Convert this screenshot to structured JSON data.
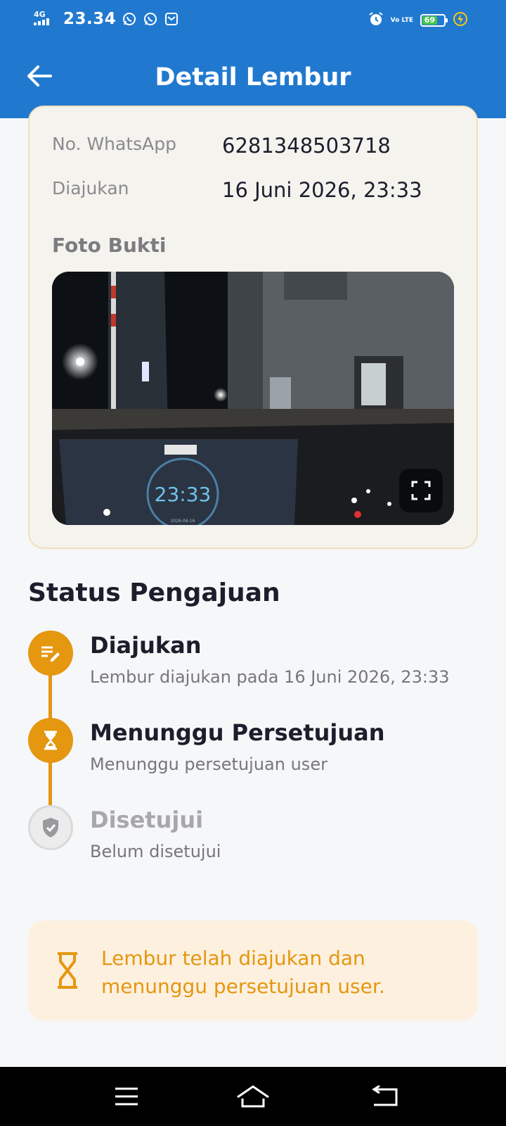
{
  "status_bar": {
    "network": "4G",
    "time": "23.34",
    "volte": "Vo LTE",
    "battery": "69",
    "battery_level": 0.69,
    "icons": [
      "whatsapp-icon",
      "whatsapp-icon",
      "message-icon",
      "alarm-icon",
      "volte-icon",
      "battery-icon",
      "charging-icon"
    ]
  },
  "app_bar": {
    "title": "Detail Lembur",
    "back_icon": "arrow-left-icon"
  },
  "detail": {
    "whatsapp_label": "No. WhatsApp",
    "whatsapp_value": "6281348503718",
    "submitted_label": "Diajukan",
    "submitted_value": "16 Juni 2026, 23:33",
    "photo_label": "Foto Bukti",
    "photo_clock": "23:33",
    "photo_date": "2026-06-16",
    "expand_icon": "fullscreen-icon"
  },
  "status": {
    "title": "Status Pengajuan",
    "steps": [
      {
        "title": "Diajukan",
        "description": "Lembur diajukan pada 16 Juni 2026, 23:33",
        "icon": "edit-note-icon",
        "state": "done"
      },
      {
        "title": "Menunggu Persetujuan",
        "description": "Menunggu persetujuan user",
        "icon": "hourglass-icon",
        "state": "current"
      },
      {
        "title": "Disetujui",
        "description": "Belum disetujui",
        "icon": "shield-check-icon",
        "state": "pending"
      }
    ]
  },
  "notice": {
    "icon": "hourglass-icon",
    "text": "Lembur telah diajukan dan menunggu persetujuan user."
  },
  "colors": {
    "primary": "#2179cf",
    "accent": "#e4970f",
    "notice_bg": "#fdf0df",
    "card_bg": "#f5f3ee",
    "card_border": "#f1dfbb"
  },
  "nav_bar": {
    "icons": [
      "menu-icon",
      "home-icon",
      "back-icon"
    ]
  }
}
